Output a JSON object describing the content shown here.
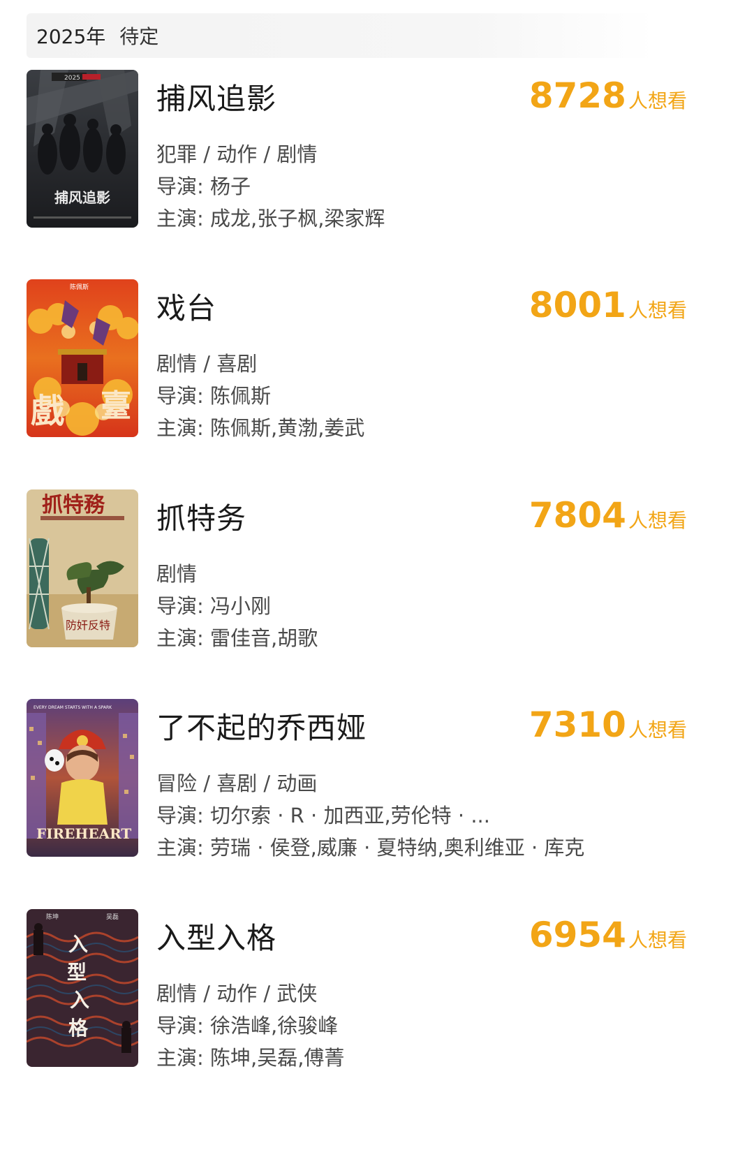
{
  "header": {
    "year": "2025年",
    "status": "待定"
  },
  "colors": {
    "accent": "#f2a516",
    "text": "#2a2a2a",
    "header_bg": "#f3f3f3"
  },
  "labels": {
    "director": "导演: ",
    "cast": "主演: ",
    "wants_unit": "人想看"
  },
  "movies": [
    {
      "title": "捕风追影",
      "wants": "8728",
      "genres": "犯罪 / 动作 / 剧情",
      "director": "杨子",
      "cast": "成龙,张子枫,梁家辉",
      "poster_icon": "poster-crime-action",
      "poster_text": "捕风追影"
    },
    {
      "title": "戏台",
      "wants": "8001",
      "genres": "剧情 / 喜剧",
      "director": "陈佩斯",
      "cast": "陈佩斯,黄渤,姜武",
      "poster_icon": "poster-stage",
      "poster_text": "戲臺"
    },
    {
      "title": "抓特务",
      "wants": "7804",
      "genres": "剧情",
      "director": "冯小刚",
      "cast": "雷佳音,胡歌",
      "poster_icon": "poster-spy",
      "poster_text": "抓特務"
    },
    {
      "title": "了不起的乔西娅",
      "wants": "7310",
      "genres": "冒险 / 喜剧 / 动画",
      "director": "切尔索 · R · 加西亚,劳伦特 · ...",
      "cast": "劳瑞 · 侯登,威廉 · 夏特纳,奥利维亚 · 库克",
      "poster_icon": "poster-fireheart",
      "poster_text": "FIREHEART"
    },
    {
      "title": "入型入格",
      "wants": "6954",
      "genres": "剧情 / 动作 / 武侠",
      "director": "徐浩峰,徐骏峰",
      "cast": "陈坤,吴磊,傅菁",
      "poster_icon": "poster-wuxia",
      "poster_text": "入型入格"
    }
  ]
}
